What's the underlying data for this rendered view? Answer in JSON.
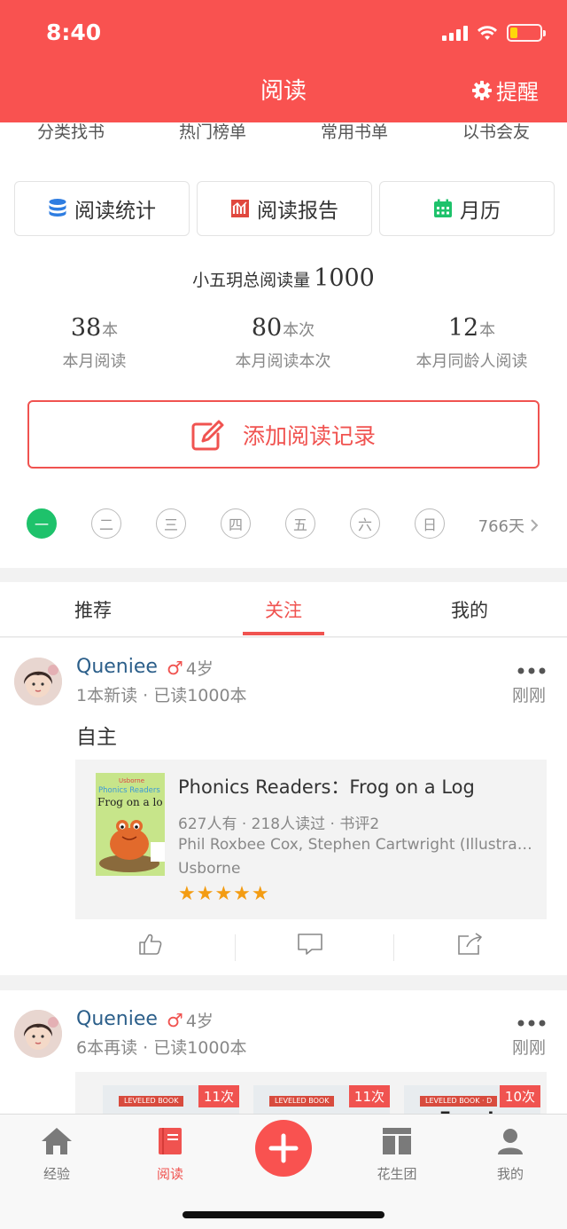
{
  "status_bar": {
    "time": "8:40"
  },
  "header": {
    "title": "阅读",
    "remind_label": "提醒"
  },
  "top_nav": [
    "分类找书",
    "热门榜单",
    "常用书单",
    "以书会友"
  ],
  "cards_row": [
    {
      "label": "阅读统计",
      "icon": "database-icon",
      "color": "#2e7de1"
    },
    {
      "label": "阅读报告",
      "icon": "report-chart-icon",
      "color": "#e0483e"
    },
    {
      "label": "月历",
      "icon": "calendar-icon",
      "color": "#1ec26b"
    }
  ],
  "summary": {
    "text": "小五玥总阅读量",
    "value": "1000"
  },
  "stats": [
    {
      "num": "38",
      "unit": "本",
      "label": "本月阅读"
    },
    {
      "num": "80",
      "unit": "本次",
      "label": "本月阅读本次"
    },
    {
      "num": "12",
      "unit": "本",
      "label": "本月同龄人阅读"
    }
  ],
  "add_record": {
    "label": "添加阅读记录"
  },
  "week_days": [
    "一",
    "二",
    "三",
    "四",
    "五",
    "六",
    "日"
  ],
  "active_day": "一",
  "streak": "766天",
  "tabs": [
    {
      "label": "推荐",
      "active": false
    },
    {
      "label": "关注",
      "active": true
    },
    {
      "label": "我的",
      "active": false
    }
  ],
  "feed": [
    {
      "user": "Queniee",
      "gender": "♂",
      "age": "4岁",
      "meta": "1本新读 · 已读1000本",
      "time": "刚刚",
      "note": "自主",
      "book": {
        "title": "Phonics Readers：Frog on a Log",
        "meta": "627人有 · 218人读过 · 书评2",
        "author": "Phil Roxbee Cox, Stephen Cartwright (Illustrator)",
        "publisher": "Usborne",
        "rating": 5,
        "stars": "★★★★★",
        "cover_series": "Usborne",
        "cover_line": "Phonics Readers",
        "cover_title": "Frog on a lo"
      }
    },
    {
      "user": "Queniee",
      "gender": "♂",
      "age": "4岁",
      "meta": "6本再读 · 已读1000本",
      "time": "刚刚",
      "thumbs": [
        {
          "label": "LEVELED BOOK",
          "count": "11次",
          "title": ""
        },
        {
          "label": "LEVELED BOOK",
          "count": "11次",
          "title": ""
        },
        {
          "label": "LEVELED BOOK · D",
          "count": "10次",
          "title": "Frog Is"
        }
      ]
    }
  ],
  "bottom_bar": [
    {
      "label": "经验",
      "icon": "home-icon",
      "active": false
    },
    {
      "label": "阅读",
      "icon": "book-icon",
      "active": true
    },
    {
      "label": "",
      "icon": "plus-icon",
      "active": false
    },
    {
      "label": "花生团",
      "icon": "group-icon",
      "active": false
    },
    {
      "label": "我的",
      "icon": "profile-icon",
      "active": false
    }
  ],
  "colors": {
    "brand": "#f95250",
    "accent_green": "#1ec26b",
    "link_blue": "#2c5f8a"
  }
}
